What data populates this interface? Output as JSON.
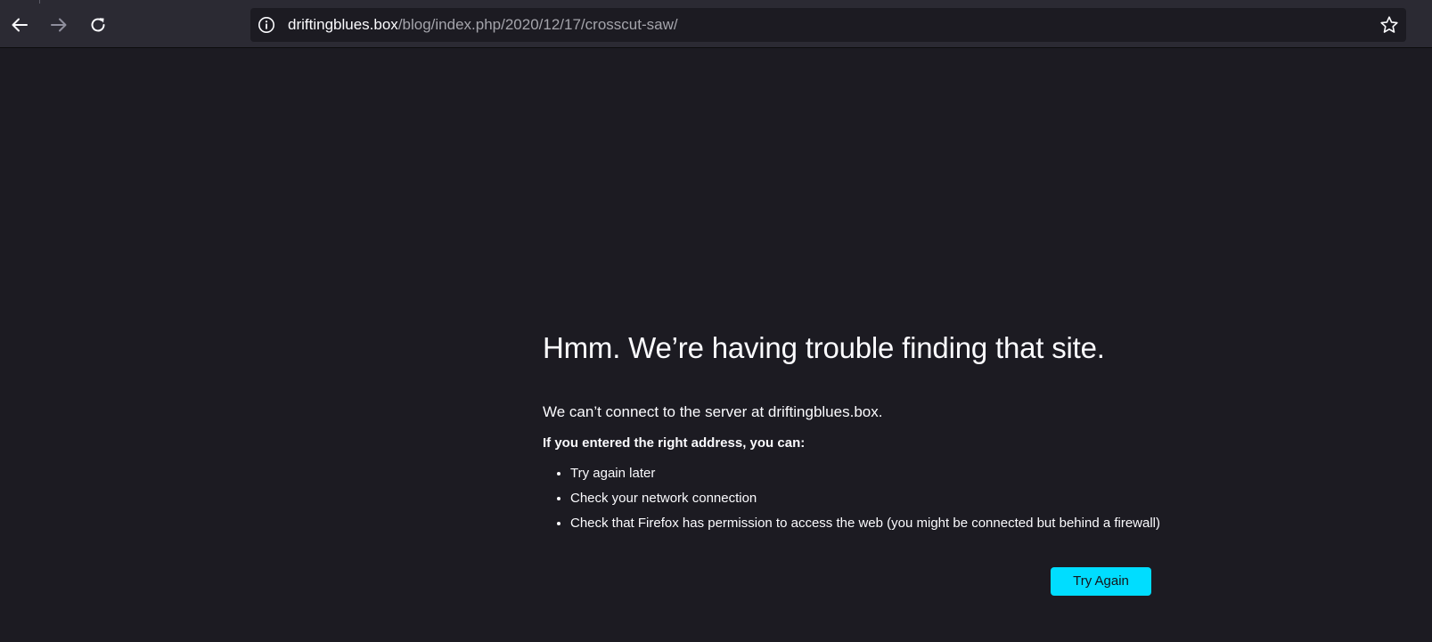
{
  "browser": {
    "nav": {
      "back_icon": "arrow-left-icon",
      "forward_icon": "arrow-right-icon",
      "reload_icon": "reload-icon"
    },
    "urlbar": {
      "info_icon": "info-icon",
      "host": "driftingblues.box",
      "path": "/blog/index.php/2020/12/17/crosscut-saw/",
      "bookmark_icon": "star-icon"
    }
  },
  "error_page": {
    "title": "Hmm. We’re having trouble finding that site.",
    "description": "We can’t connect to the server at driftingblues.box.",
    "hint": "If you entered the right address, you can:",
    "suggestions": [
      "Try again later",
      "Check your network connection",
      "Check that Firefox has permission to access the web (you might be connected but behind a firewall)"
    ],
    "try_again_label": "Try Again"
  },
  "colors": {
    "page_background": "#1c1b22",
    "toolbar_background": "#2b2a33",
    "accent_button": "#00ddff",
    "text_primary": "#fbfbfe",
    "text_secondary": "#a4a4ab"
  }
}
